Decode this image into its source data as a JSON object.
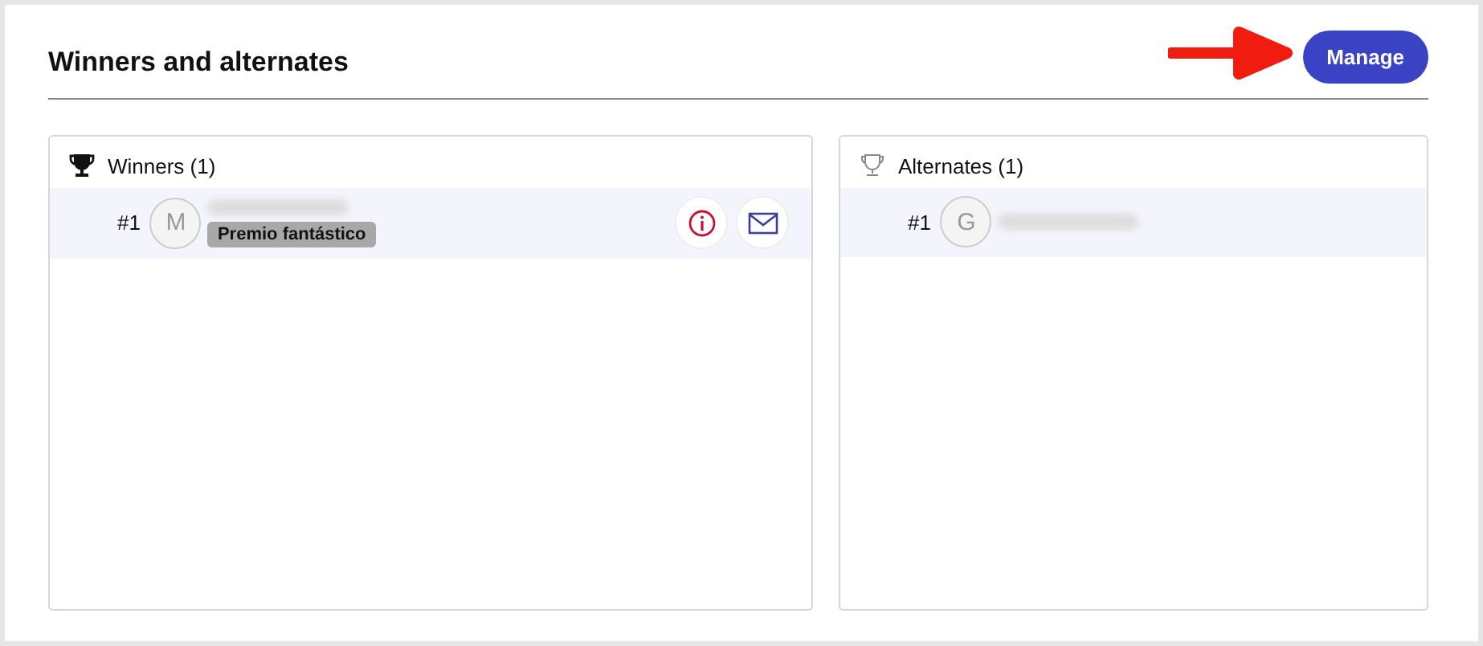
{
  "title": "Winners and alternates",
  "manage_button": {
    "label": "Manage"
  },
  "panels": [
    {
      "title": "Winners (1)",
      "kind": "filled",
      "rows": [
        {
          "rank": "#1",
          "initial": "M",
          "prize": "Premio fantástico",
          "actions": [
            {
              "kind": "info"
            },
            {
              "kind": "mail"
            }
          ]
        }
      ]
    },
    {
      "title": "Alternates (1)",
      "kind": "outline",
      "rows": [
        {
          "rank": "#1",
          "initial": "G",
          "actions": []
        }
      ]
    }
  ]
}
